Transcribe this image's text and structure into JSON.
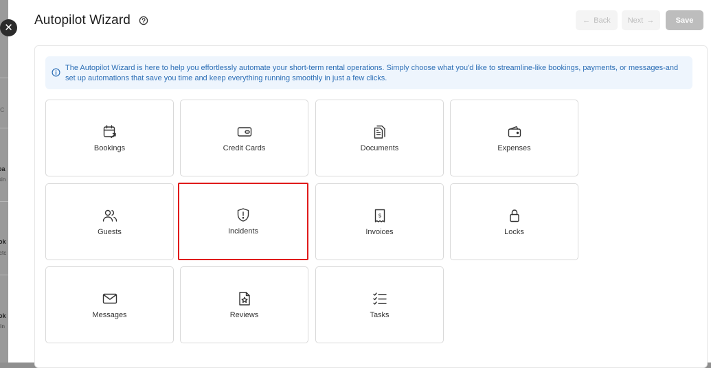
{
  "backdrop": {
    "fragments": [
      "’C",
      "oa",
      "kin",
      "ok",
      "ctc",
      "ok",
      "lin"
    ]
  },
  "header": {
    "title": "Autopilot Wizard",
    "back_label": "Back",
    "next_label": "Next",
    "save_label": "Save"
  },
  "info_banner": {
    "text": "The Autopilot Wizard is here to help you effortlessly automate your short-term rental operations. Simply choose what you'd like to streamline-like bookings, payments, or messages-and set up automations that save you time and keep everything running smoothly in just a few clicks."
  },
  "cards": [
    {
      "label": "Bookings",
      "icon": "calendar-icon"
    },
    {
      "label": "Credit Cards",
      "icon": "wallet-card-icon"
    },
    {
      "label": "Documents",
      "icon": "documents-icon"
    },
    {
      "label": "Expenses",
      "icon": "wallet-icon"
    },
    {
      "label": "Guests",
      "icon": "users-icon"
    },
    {
      "label": "Incidents",
      "icon": "shield-alert-icon",
      "selected": true
    },
    {
      "label": "Invoices",
      "icon": "receipt-dollar-icon"
    },
    {
      "label": "Locks",
      "icon": "lock-icon"
    },
    {
      "label": "Messages",
      "icon": "envelope-icon"
    },
    {
      "label": "Reviews",
      "icon": "star-file-icon"
    },
    {
      "label": "Tasks",
      "icon": "checklist-icon"
    }
  ],
  "colors": {
    "selected_border": "#e01a1a",
    "info_background": "#eef5fd",
    "info_text": "#2d6fb6",
    "save_disabled": "#bdbdbd"
  }
}
